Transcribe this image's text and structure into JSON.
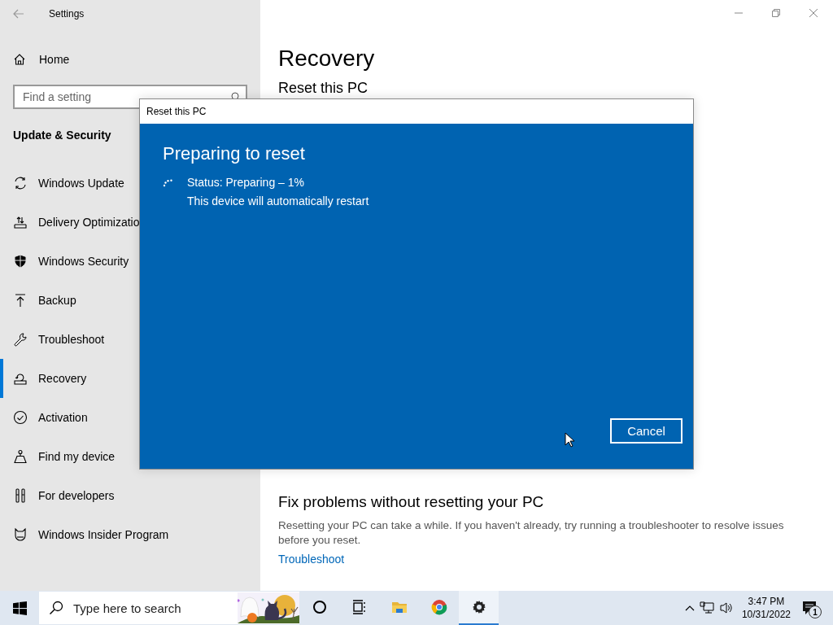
{
  "window": {
    "title": "Settings"
  },
  "sidebar": {
    "home": "Home",
    "search": {
      "placeholder": "Find a setting"
    },
    "section": "Update & Security",
    "items": [
      {
        "label": "Windows Update",
        "selected": false
      },
      {
        "label": "Delivery Optimizatio",
        "selected": false
      },
      {
        "label": "Windows Security",
        "selected": false
      },
      {
        "label": "Backup",
        "selected": false
      },
      {
        "label": "Troubleshoot",
        "selected": false
      },
      {
        "label": "Recovery",
        "selected": true
      },
      {
        "label": "Activation",
        "selected": false
      },
      {
        "label": "Find my device",
        "selected": false
      },
      {
        "label": "For developers",
        "selected": false
      },
      {
        "label": "Windows Insider Program",
        "selected": false
      }
    ]
  },
  "main": {
    "title": "Recovery",
    "section": "Reset this PC",
    "fix_heading": "Fix problems without resetting your PC",
    "fix_text": "Resetting your PC can take a while. If you haven't already, try running a troubleshooter to resolve issues before you reset.",
    "fix_link": "Troubleshoot"
  },
  "dialog": {
    "title": "Reset this PC",
    "heading": "Preparing to reset",
    "status": "Status: Preparing – 1%",
    "note": "This device will automatically restart",
    "cancel": "Cancel"
  },
  "taskbar": {
    "search": {
      "placeholder": "Type here to search"
    },
    "apps": [
      {
        "selected": false
      },
      {
        "selected": false
      },
      {
        "selected": false
      },
      {
        "selected": false
      },
      {
        "selected": true
      }
    ],
    "time": "3:47 PM",
    "date": "10/31/2022",
    "notifications": "1"
  }
}
